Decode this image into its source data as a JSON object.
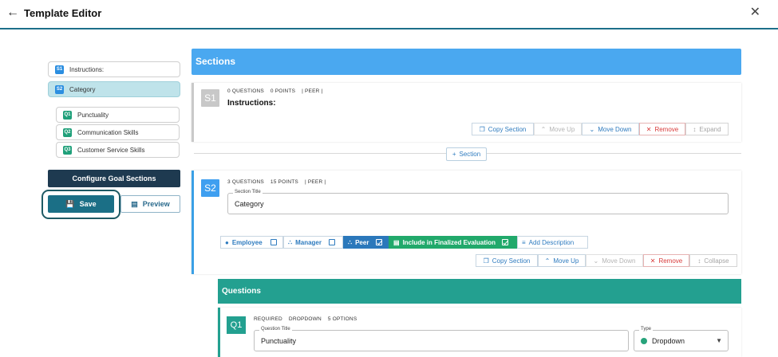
{
  "header": {
    "title": "Template Editor",
    "back_icon": "arrow-left-icon",
    "close_icon": "close-icon"
  },
  "sidebar": {
    "items": [
      {
        "badge": "S1",
        "label": "Instructions:",
        "active": false
      },
      {
        "badge": "S2",
        "label": "Category",
        "active": true
      }
    ],
    "questions": [
      {
        "badge": "Q1",
        "label": "Punctuality"
      },
      {
        "badge": "Q2",
        "label": "Communication Skills"
      },
      {
        "badge": "Q3",
        "label": "Customer Service Skills"
      }
    ],
    "configure_label": "Configure Goal Sections",
    "save_label": "Save",
    "preview_label": "Preview"
  },
  "main": {
    "sections_title": "Sections",
    "section1": {
      "badge": "S1",
      "questions": "0 QUESTIONS",
      "points": "0 POINTS",
      "type": "| PEER |",
      "title": "Instructions:",
      "actions": {
        "copy": "Copy Section",
        "up": "Move Up",
        "down": "Move Down",
        "remove": "Remove",
        "expand": "Expand"
      }
    },
    "add_section_label": "Section",
    "section2": {
      "badge": "S2",
      "questions": "3 QUESTIONS",
      "points": "15 POINTS",
      "type": "| PEER |",
      "field_label": "Section Title",
      "field_value": "Category",
      "chips": {
        "employee": "Employee",
        "manager": "Manager",
        "peer": "Peer",
        "final": "Include in Finalized Evaluation",
        "desc": "Add Description"
      },
      "actions": {
        "copy": "Copy Section",
        "up": "Move Up",
        "down": "Move Down",
        "remove": "Remove",
        "collapse": "Collapse"
      }
    },
    "questions_title": "Questions",
    "q1": {
      "badge": "Q1",
      "required": "REQUIRED",
      "kind": "DROPDOWN",
      "options": "5 OPTIONS",
      "field_label": "Question Title",
      "field_value": "Punctuality",
      "type_label": "Type",
      "type_value": "Dropdown"
    }
  },
  "colors": {
    "accent": "#1b6f86",
    "sections_header": "#4aa8f0",
    "questions_header": "#23a090",
    "remove": "#d93b3b"
  }
}
